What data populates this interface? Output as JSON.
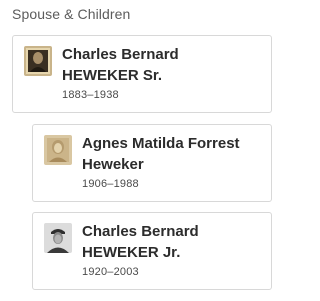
{
  "section": {
    "title": "Spouse & Children"
  },
  "people": [
    {
      "name": "Charles Bernard HEWEKER Sr.",
      "dates": "1883–1938",
      "photo_icon": "portrait-photo-man-icon"
    },
    {
      "name": "Agnes Matilda Forrest Heweker",
      "dates": "1906–1988",
      "photo_icon": "portrait-photo-woman-icon"
    },
    {
      "name": "Charles Bernard HEWEKER Jr.",
      "dates": "1920–2003",
      "photo_icon": "portrait-photo-soldier-icon"
    }
  ],
  "colors": {
    "section_title": "#5c5c5c",
    "card_border": "#d8d8d8",
    "name_text": "#2c2c2c",
    "dates_text": "#4a4a4a"
  }
}
